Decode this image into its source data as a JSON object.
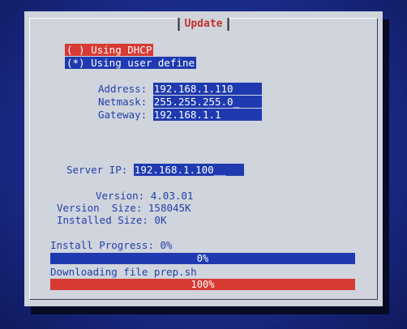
{
  "dialog": {
    "title": "Update",
    "network": {
      "option_dhcp": "( ) Using DHCP",
      "option_user": "(*) Using user define",
      "address_label": "Address:",
      "address_value": "192.168.1.110",
      "netmask_label": "Netmask:",
      "netmask_value": "255.255.255.0_",
      "gateway_label": "Gateway:",
      "gateway_value": "192.168.1.1"
    },
    "server": {
      "label": "Server IP:",
      "value": "192.168.1.100__"
    },
    "info": {
      "version_label": "Version:",
      "version_value": "4.03.01",
      "version_size_label": "Version  Size:",
      "version_size_value": "158045K",
      "installed_size_label": "Installed Size:",
      "installed_size_value": "0K"
    },
    "progress": {
      "install_label": "Install Progress:",
      "install_value": "0%",
      "install_bar_text": "0%",
      "install_fraction": 0,
      "download_text": "Downloading file prep.sh",
      "download_bar_text": "100%",
      "download_fraction": 1
    }
  },
  "colors": {
    "background": "#1c2e8c",
    "dialog": "#cfd4dd",
    "accent_blue": "#1f3ab0",
    "accent_red": "#d73a33",
    "label_text": "#2340a8",
    "title_text": "#c2322b"
  }
}
